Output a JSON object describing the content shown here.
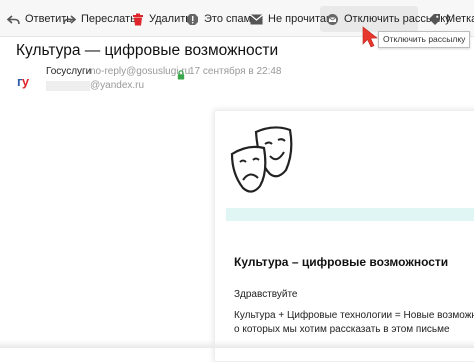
{
  "toolbar": {
    "reply": "Ответить",
    "forward": "Переслать",
    "delete": "Удалить",
    "spam": "Это спам!",
    "unread": "Не прочитано",
    "unsubscribe": "Отключить рассылку",
    "label": "Метка"
  },
  "tooltip": "Отключить рассылку",
  "message": {
    "subject": "Культура — цифровые возможности",
    "avatar_g": "г",
    "avatar_u": "у",
    "sender_name": "Госуслуги",
    "sender_email": "no-reply@gosuslugi.ru",
    "date": "17 сентября в 22:48",
    "recipient": "@yandex.ru"
  },
  "content": {
    "title": "Культура – цифровые возможности",
    "greeting": "Здравствуйте",
    "line1": "Культура + Цифровые технологии = Новые возможнос",
    "line2": "о которых мы хотим рассказать в этом письме"
  },
  "colors": {
    "cursor": "#e8372c",
    "avatar_blue": "#2f5aa8",
    "avatar_red": "#e0242b",
    "delete_red": "#e0242b",
    "accent_band": "#dff6f4"
  },
  "icons": [
    "reply-icon",
    "forward-icon",
    "trash-icon",
    "spam-icon",
    "envelope-icon",
    "unsubscribe-icon",
    "tag-icon",
    "lock-icon",
    "theater-masks-icon",
    "cursor-arrow-icon"
  ]
}
